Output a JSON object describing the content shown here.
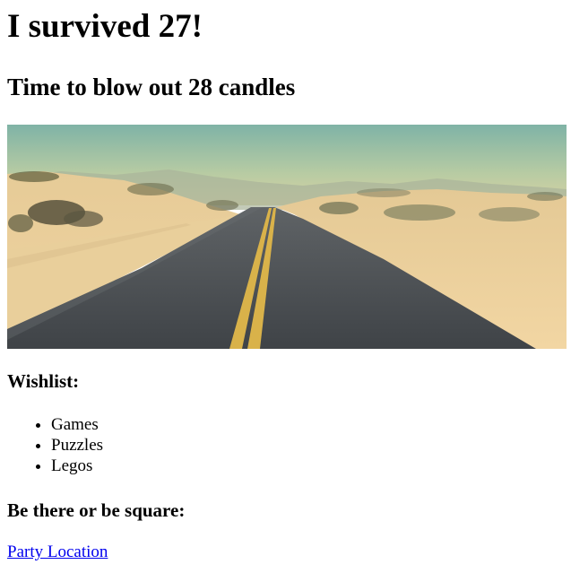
{
  "header": {
    "title": "I survived 27!",
    "subtitle": "Time to blow out 28 candles"
  },
  "hero": {
    "icon": "desert-road-photo"
  },
  "wishlist": {
    "heading": "Wishlist:",
    "items": [
      "Games",
      "Puzzles",
      "Legos"
    ]
  },
  "invite": {
    "heading": "Be there or be square:",
    "link_label": "Party Location",
    "link_color": "#0000ee"
  }
}
